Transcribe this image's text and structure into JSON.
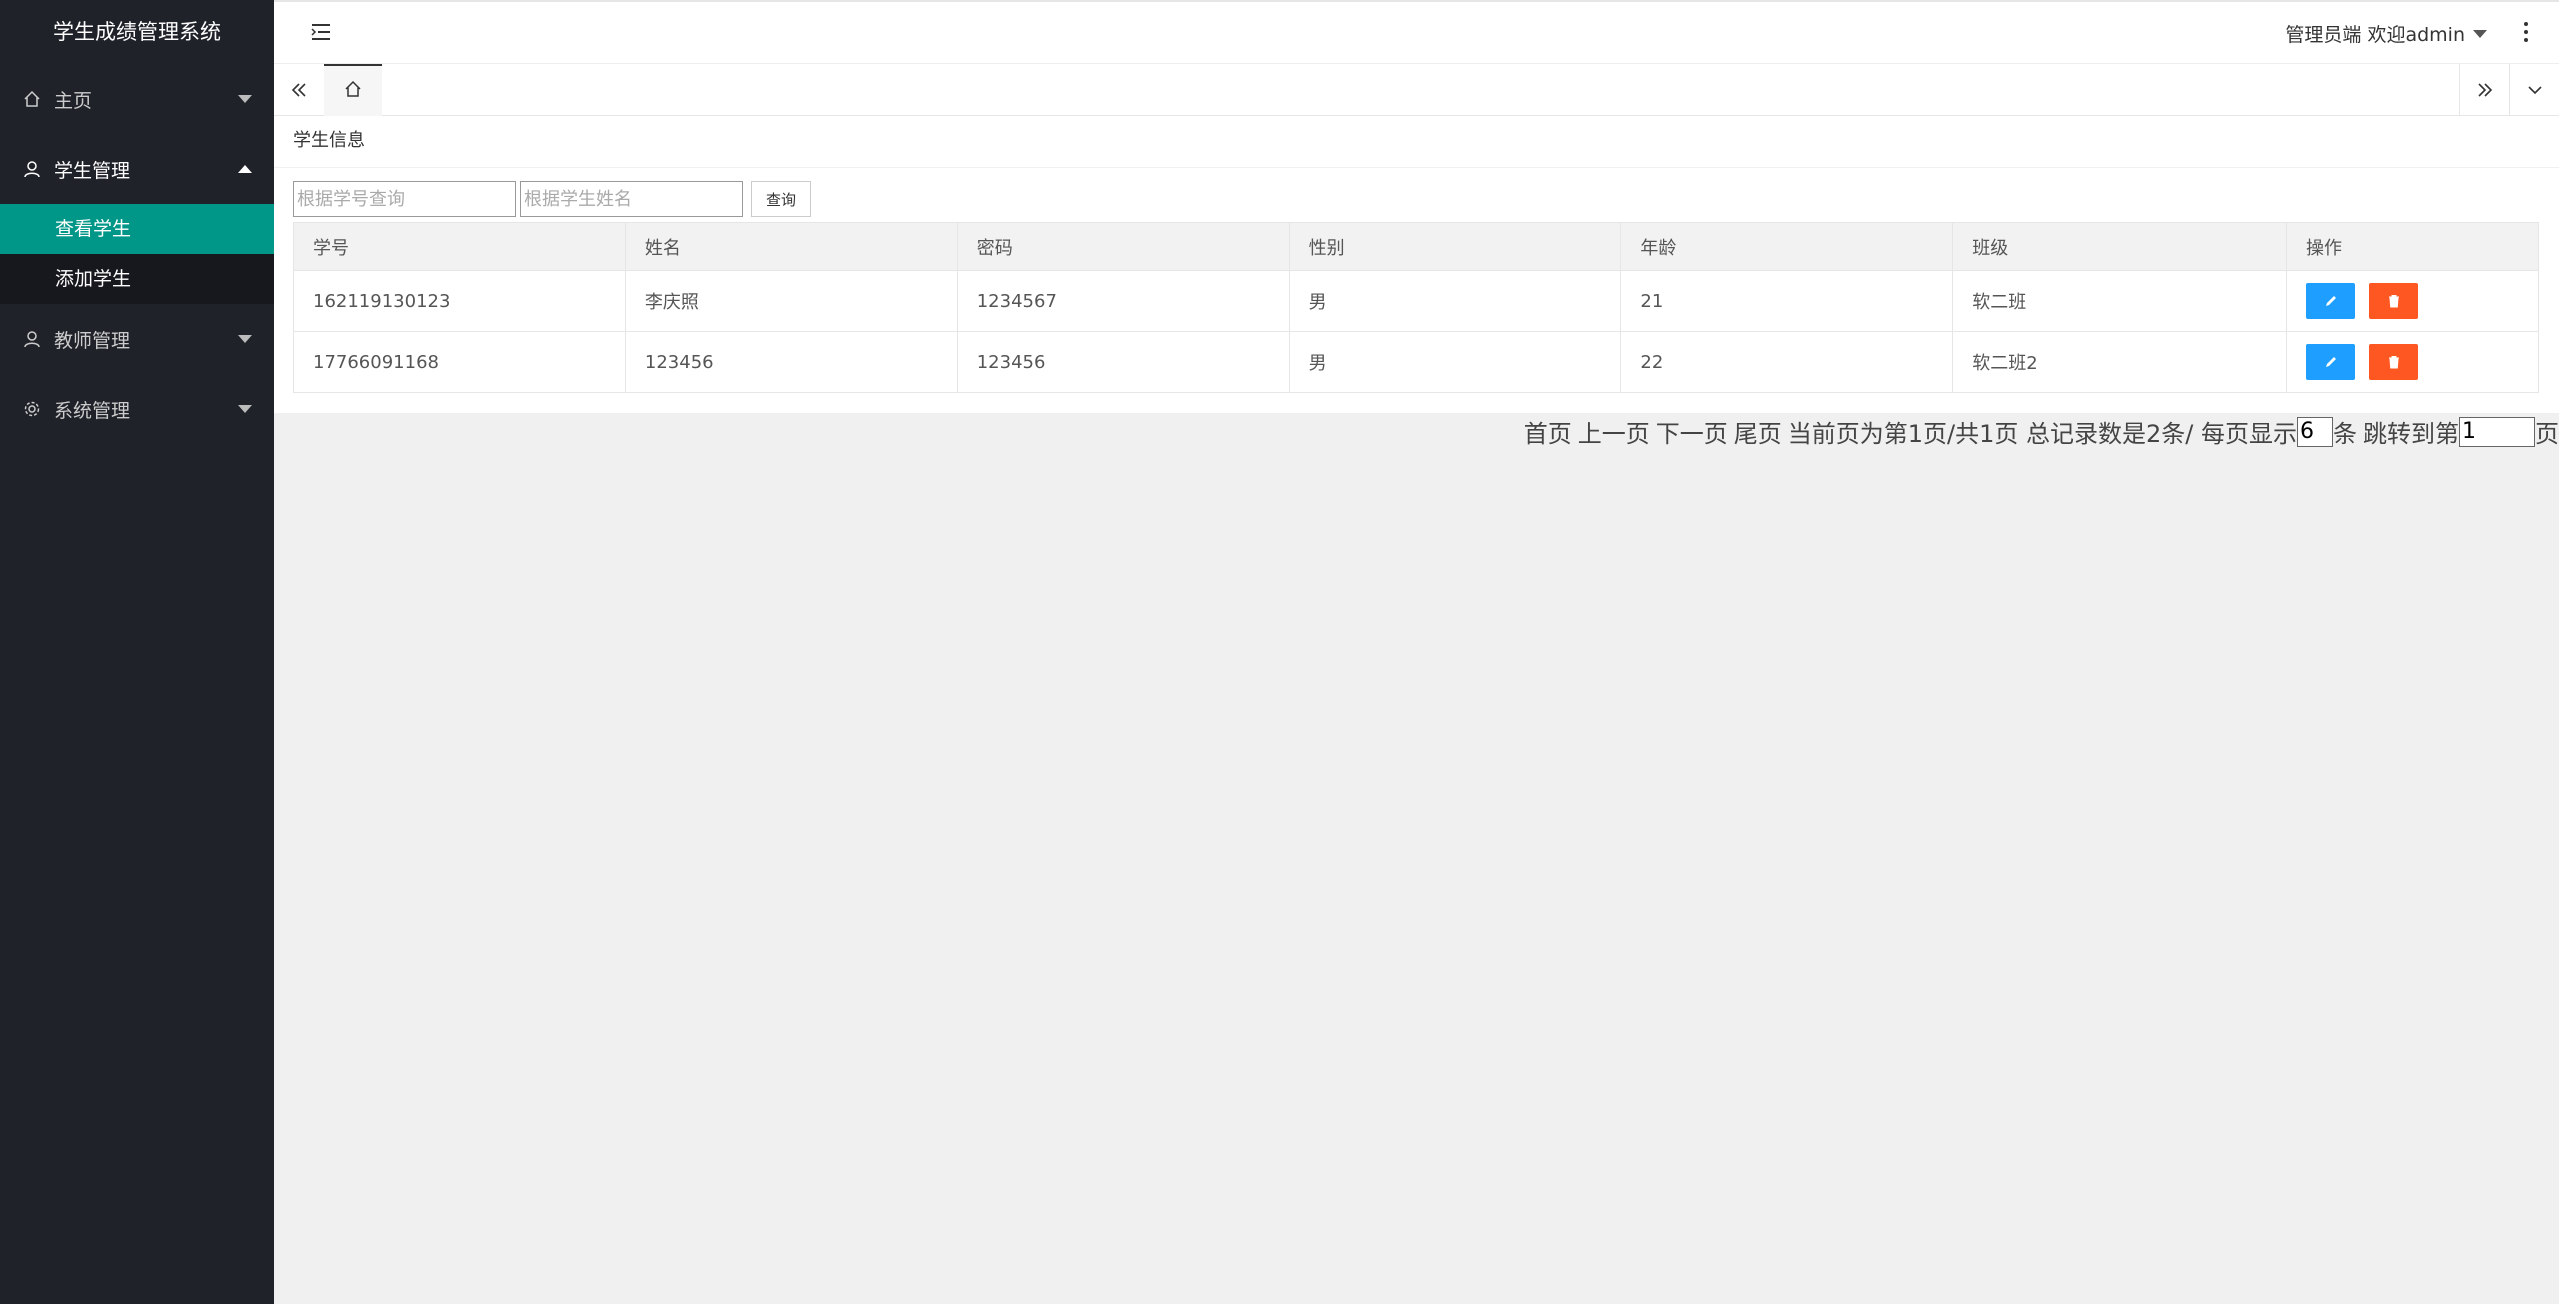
{
  "app": {
    "title": "学生成绩管理系统"
  },
  "sidebar": {
    "items": [
      {
        "label": "主页",
        "icon": "home-icon",
        "expanded": false
      },
      {
        "label": "学生管理",
        "icon": "user-icon",
        "expanded": true,
        "children": [
          {
            "label": "查看学生",
            "selected": true
          },
          {
            "label": "添加学生",
            "selected": false
          }
        ]
      },
      {
        "label": "教师管理",
        "icon": "user-icon",
        "expanded": false
      },
      {
        "label": "系统管理",
        "icon": "gear-icon",
        "expanded": false
      }
    ]
  },
  "header": {
    "user_label": "管理员端 欢迎admin"
  },
  "panel": {
    "title": "学生信息"
  },
  "search": {
    "id_placeholder": "根据学号查询",
    "name_placeholder": "根据学生姓名",
    "button_label": "查询"
  },
  "table": {
    "columns": [
      "学号",
      "姓名",
      "密码",
      "性别",
      "年龄",
      "班级",
      "操作"
    ],
    "rows": [
      [
        "162119130123",
        "李庆照",
        "1234567",
        "男",
        "21",
        "软二班"
      ],
      [
        "17766091168",
        "123456",
        "123456",
        "男",
        "22",
        "软二班2"
      ]
    ]
  },
  "pager": {
    "first": "首页",
    "prev": "上一页",
    "next": "下一页",
    "last": "尾页",
    "status": "当前页为第1页/共1页 总记录数是2条/ 每页显示",
    "page_size": "6",
    "unit": "条",
    "jump_label": "跳转到第",
    "jump_value": "1",
    "page_suffix": "页"
  },
  "colors": {
    "sidebar_bg": "#20222a",
    "selected": "#009688",
    "edit": "#1e9fff",
    "delete": "#ff5722"
  }
}
